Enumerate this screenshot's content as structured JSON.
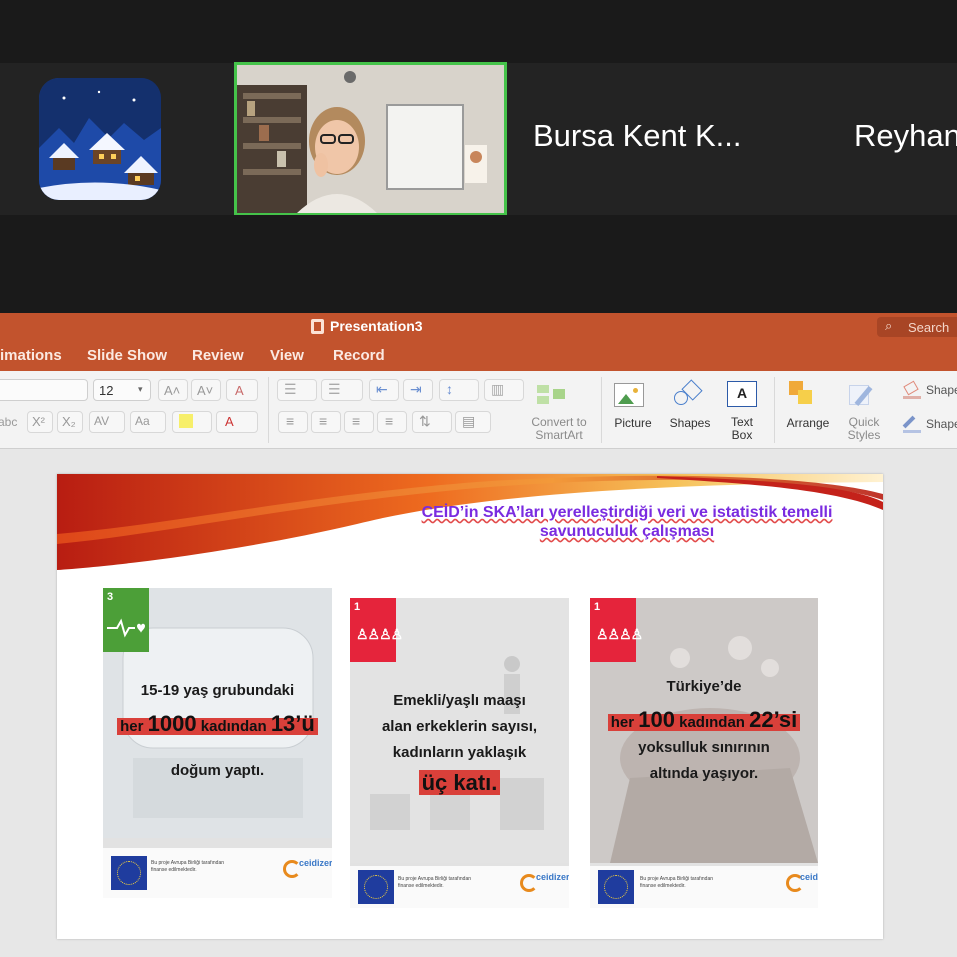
{
  "gallery": {
    "participants": [
      {
        "name": ""
      },
      {
        "name": ""
      },
      {
        "name": "Bursa Kent K..."
      },
      {
        "name": "Reyhan"
      }
    ]
  },
  "ppt": {
    "window_title": "Presentation3",
    "search_placeholder": "Search",
    "tabs": [
      "imations",
      "Slide Show",
      "Review",
      "View",
      "Record"
    ],
    "ribbon": {
      "font_size": "12",
      "convert_line1": "Convert to",
      "convert_line2": "SmartArt",
      "picture": "Picture",
      "shapes": "Shapes",
      "textbox_line1": "Text",
      "textbox_line2": "Box",
      "arrange": "Arrange",
      "quick_line1": "Quick",
      "quick_line2": "Styles",
      "shape1": "Shape",
      "shape2": "Shape",
      "abc": "abc"
    },
    "slide": {
      "title_line1": "CEİD’in SKA’ları yerelleştirdiği veri ve istatistik temelli",
      "title_line2": "savunuculuk çalışması",
      "cards": [
        {
          "sdg": "3",
          "line1": "15-19 yaş grubundaki",
          "hl_pre": "her",
          "hl_num1": "1000",
          "hl_mid": "kadından",
          "hl_num2": "13’ü",
          "line3": "doğum yaptı."
        },
        {
          "sdg": "1",
          "line1": "Emekli/yaşlı maaşı",
          "line2": "alan erkeklerin sayısı,",
          "line3": "kadınların yaklaşık",
          "hl": "üç katı."
        },
        {
          "sdg": "1",
          "line1": "Türkiye’de",
          "hl_pre": "her",
          "hl_num1": "100",
          "hl_mid": "kadından",
          "hl_num2": "22’si",
          "line3": "yoksulluk sınırının",
          "line4": "altında yaşıyor."
        }
      ],
      "funding_text": "Bu proje Avrupa Birliği tarafından finanse edilmektedir.",
      "ceid_logo": "ceidizer"
    }
  },
  "colors": {
    "ppt_accent": "#c2532d",
    "speaker_border": "#45c34a",
    "slide_title": "#7a2be0",
    "highlight": "#d9403a",
    "sdg3_green": "#4c9f38",
    "sdg1_red": "#e5243b"
  }
}
